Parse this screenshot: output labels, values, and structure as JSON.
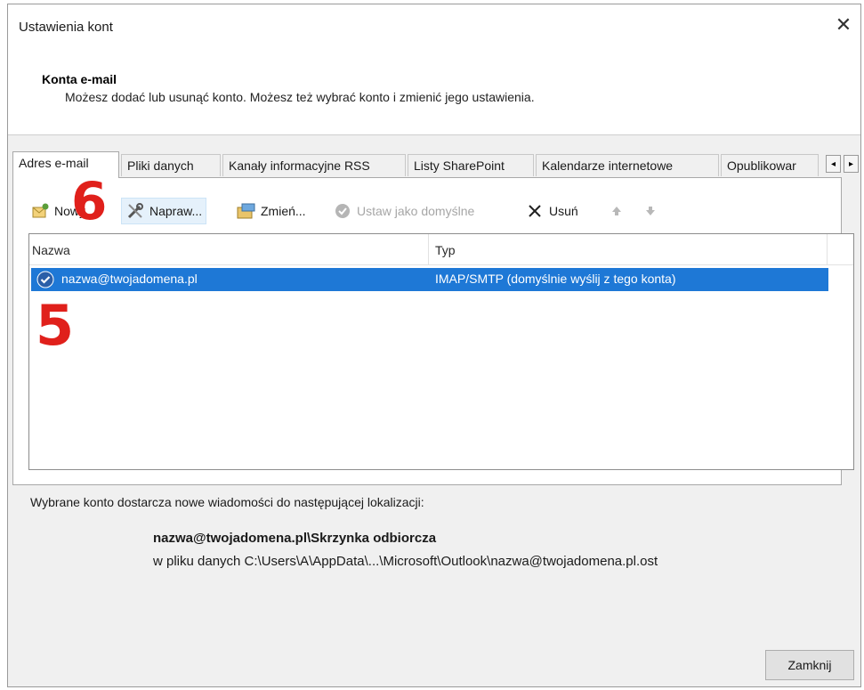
{
  "window": {
    "title": "Ustawienia kont",
    "close_glyph": "✕"
  },
  "header": {
    "heading": "Konta e-mail",
    "description": "Możesz dodać lub usunąć konto. Możesz też wybrać konto i zmienić jego ustawienia."
  },
  "tabs": [
    {
      "label": "Adres e-mail",
      "active": true
    },
    {
      "label": "Pliki danych"
    },
    {
      "label": "Kanały informacyjne RSS"
    },
    {
      "label": "Listy SharePoint"
    },
    {
      "label": "Kalendarze internetowe"
    },
    {
      "label": "Opublikowar"
    }
  ],
  "tab_scroll": {
    "left": "◂",
    "right": "▸"
  },
  "toolbar": {
    "new": "Nowy...",
    "repair": "Napraw...",
    "change": "Zmień...",
    "set_default": "Ustaw jako domyślne",
    "remove": "Usuń"
  },
  "annotations": {
    "six": "6",
    "five": "5"
  },
  "accounts_list": {
    "col_name": "Nazwa",
    "col_type": "Typ",
    "rows": [
      {
        "name": "nazwa@twojadomena.pl",
        "type": "IMAP/SMTP (domyślnie wyślij z tego konta)"
      }
    ]
  },
  "delivery": {
    "info": "Wybrane konto dostarcza nowe wiadomości do następującej lokalizacji:",
    "folder": "nazwa@twojadomena.pl\\Skrzynka odbiorcza",
    "path": "w pliku danych C:\\Users\\A\\AppData\\...\\Microsoft\\Outlook\\nazwa@twojadomena.pl.ost"
  },
  "buttons": {
    "close": "Zamknij"
  },
  "colors": {
    "selection": "#1e78d6",
    "annotation": "#e0201b"
  },
  "icons": [
    "new-account-icon",
    "repair-tools-icon",
    "change-account-icon",
    "set-default-check-icon",
    "remove-x-icon",
    "move-up-icon",
    "move-down-icon",
    "default-account-check-icon"
  ]
}
